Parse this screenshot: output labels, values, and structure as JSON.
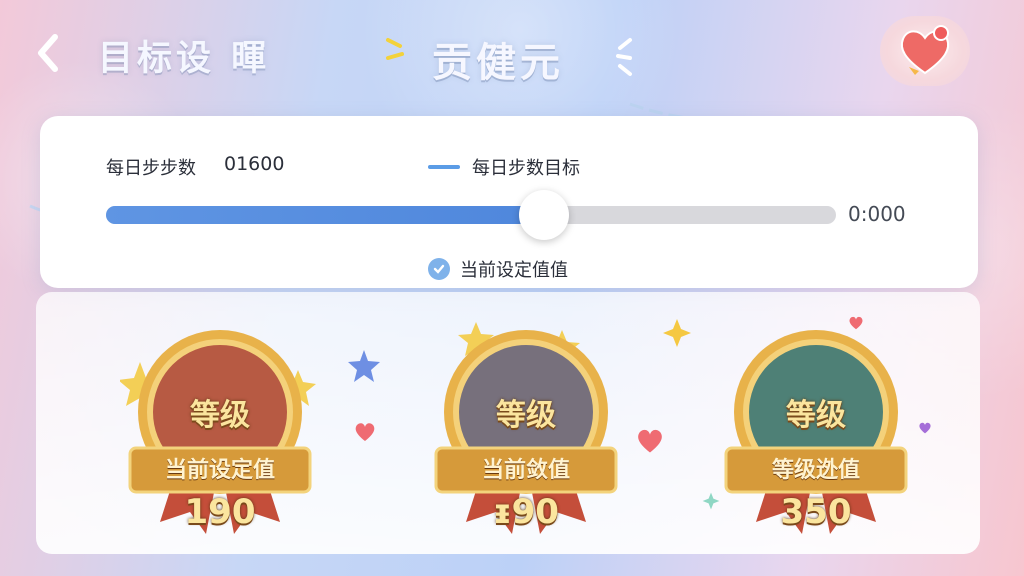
{
  "header": {
    "title": "目标设 暉",
    "center_title": "贡健元"
  },
  "slider_card": {
    "label": "每日步步数",
    "value": "01600",
    "legend_label": "每日步数目标",
    "max_value": "0:000",
    "current_label": "当前设定值值",
    "fill_fraction": 0.6
  },
  "medals": [
    {
      "top_label": "等级",
      "ribbon_label": "当前设定值",
      "value": "190",
      "color": "#b75a43"
    },
    {
      "top_label": "等级",
      "ribbon_label": "当前敛值",
      "value": "ᵻ90",
      "color": "#77707c"
    },
    {
      "top_label": "等级",
      "ribbon_label": "等级迯值",
      "value": "350",
      "color": "#4e8076"
    }
  ],
  "icons": {
    "back": "chevron-left-icon",
    "heart": "heart-icon",
    "check": "check-circle-icon"
  },
  "colors": {
    "accent_blue": "#5b9ce6",
    "gold": "#e7b348"
  }
}
